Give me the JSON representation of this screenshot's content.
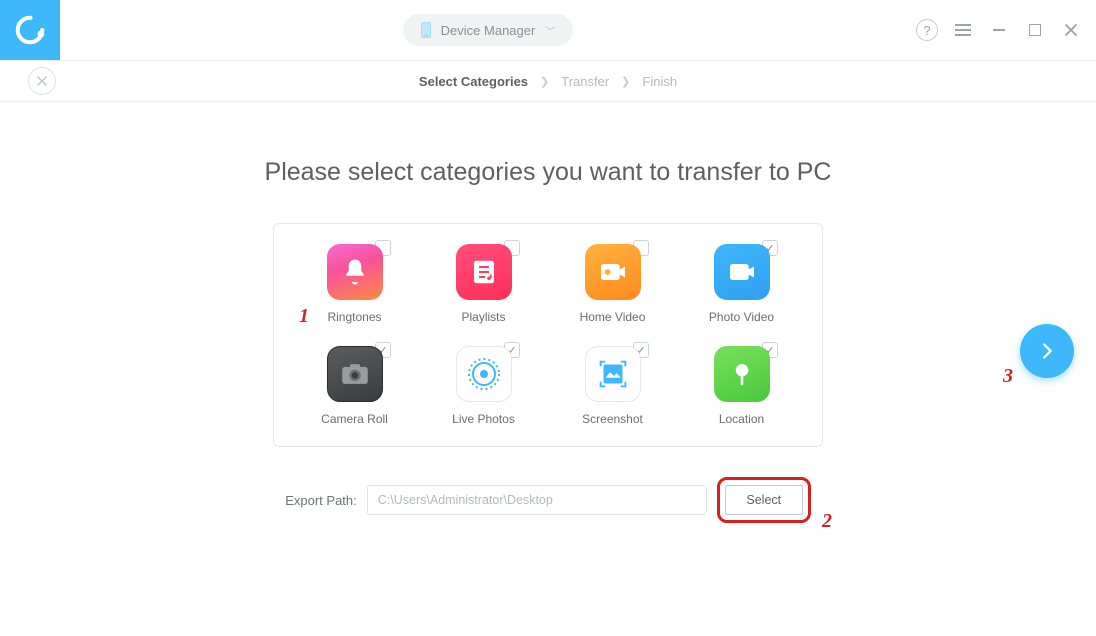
{
  "header": {
    "device_label": "Device Manager"
  },
  "breadcrumb": {
    "step1": "Select Categories",
    "step2": "Transfer",
    "step3": "Finish"
  },
  "page": {
    "title": "Please select categories you want to transfer to PC"
  },
  "categories": {
    "ringtones": {
      "label": "Ringtones",
      "checked": false
    },
    "playlists": {
      "label": "Playlists",
      "checked": false
    },
    "home_video": {
      "label": "Home Video",
      "checked": false
    },
    "photo_video": {
      "label": "Photo Video",
      "checked": true
    },
    "camera_roll": {
      "label": "Camera Roll",
      "checked": true
    },
    "live_photos": {
      "label": "Live Photos",
      "checked": true
    },
    "screenshot": {
      "label": "Screenshot",
      "checked": true
    },
    "location": {
      "label": "Location",
      "checked": true
    }
  },
  "export": {
    "label": "Export Path:",
    "path_value": "C:\\Users\\Administrator\\Desktop",
    "select_label": "Select"
  },
  "annotations": {
    "one": "1",
    "two": "2",
    "three": "3"
  }
}
